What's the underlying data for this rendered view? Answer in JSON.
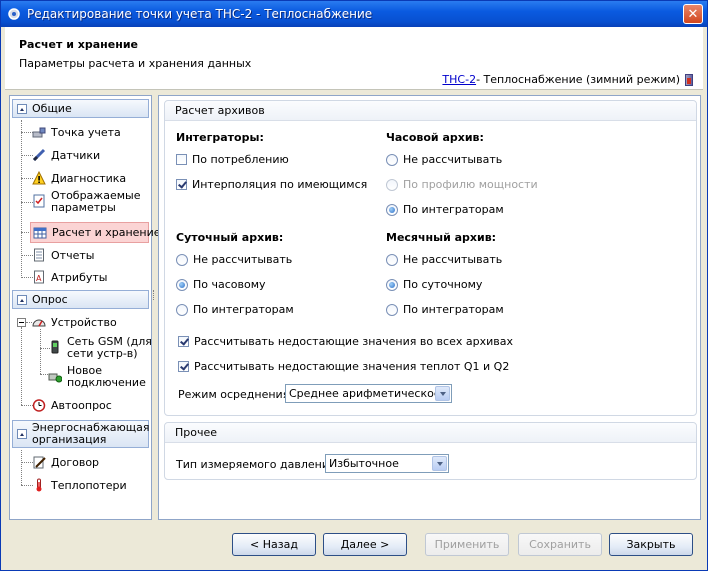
{
  "window": {
    "title": "Редактирование точки учета ТНС-2 - Теплоснабжение"
  },
  "header": {
    "title": "Расчет и хранение",
    "subtitle": "Параметры расчета и хранения данных",
    "link": "ТНС-2",
    "context": " - Теплоснабжение (зимний режим)"
  },
  "nav": {
    "groups": [
      "Общие",
      "Опрос",
      "Энергоснабжающая организация"
    ],
    "general": [
      "Точка учета",
      "Датчики",
      "Диагностика",
      "Отображаемые параметры",
      "Расчет и хранение",
      "Отчеты",
      "Атрибуты"
    ],
    "poll": {
      "device": "Устройство",
      "gsm": "Сеть GSM (для сети устр-в)",
      "new_conn": "Новое подключение",
      "autopoll": "Автоопрос"
    },
    "energy": [
      "Договор",
      "Теплопотери"
    ]
  },
  "archives": {
    "section_title": "Расчет архивов",
    "integrators": {
      "label": "Интеграторы:",
      "options": [
        "По потреблению",
        "Интерполяция по имеющимся"
      ]
    },
    "hourly": {
      "label": "Часовой архив:",
      "options": [
        "Не рассчитывать",
        "По профилю мощности",
        "По интеграторам"
      ]
    },
    "daily": {
      "label": "Суточный архив:",
      "options": [
        "Не рассчитывать",
        "По часовому",
        "По интеграторам"
      ]
    },
    "monthly": {
      "label": "Месячный архив:",
      "options": [
        "Не рассчитывать",
        "По суточному",
        "По интеграторам"
      ]
    },
    "calc_missing_all": "Рассчитывать недостающие значения во всех архивах",
    "calc_missing_q": "Рассчитывать недостающие значения теплот Q1 и Q2",
    "averaging_label": "Режим осреднения:",
    "averaging_value": "Среднее арифметическое"
  },
  "other": {
    "section_title": "Прочее",
    "pressure_label": "Тип измеряемого давления:",
    "pressure_value": "Избыточное"
  },
  "buttons": {
    "back": "< Назад",
    "next": "Далее >",
    "apply": "Применить",
    "save": "Сохранить",
    "close": "Закрыть"
  }
}
